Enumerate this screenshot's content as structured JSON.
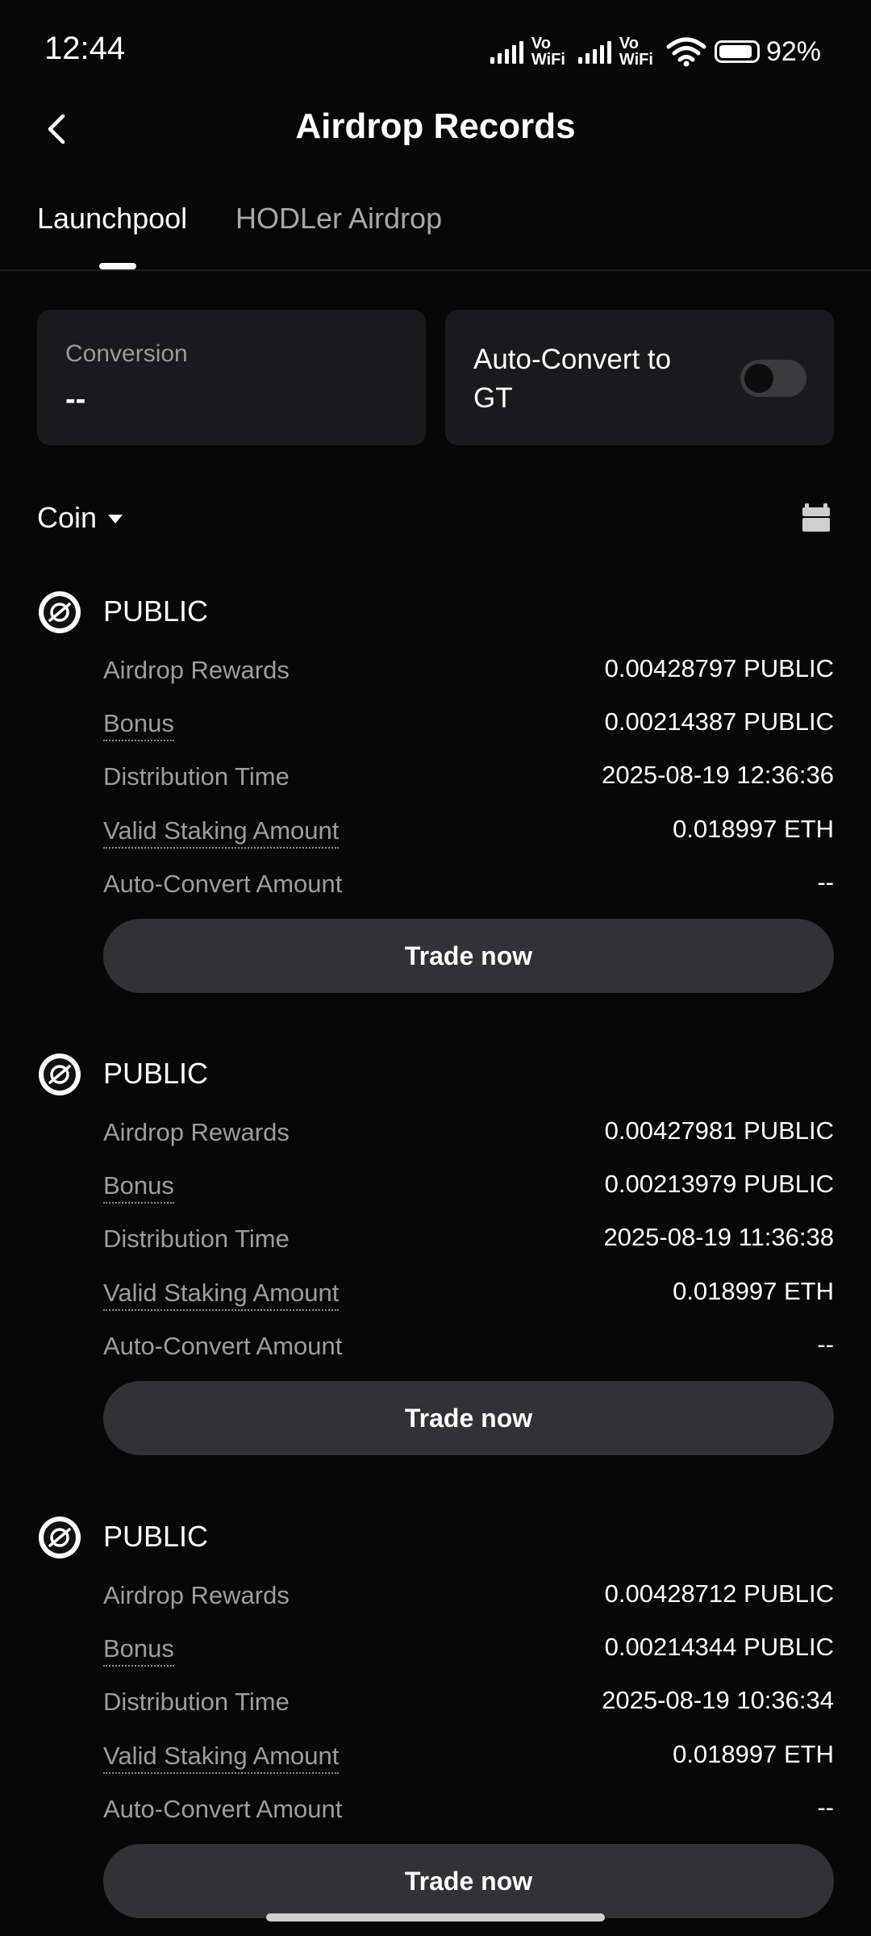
{
  "status_bar": {
    "time": "12:44",
    "vowifi_1": "Vo\nWiFi",
    "vowifi_2": "Vo\nWiFi",
    "battery": "92%"
  },
  "header": {
    "title": "Airdrop Records",
    "back_icon": "chevron-left-icon"
  },
  "tabs": [
    {
      "label": "Launchpool",
      "active": true
    },
    {
      "label": "HODLer Airdrop",
      "active": false
    }
  ],
  "summary": {
    "conversion_label": "Conversion",
    "conversion_value": "--",
    "auto_convert_label": "Auto-Convert to GT",
    "auto_convert_enabled": false
  },
  "filter": {
    "label": "Coin",
    "calendar_icon": "calendar-icon"
  },
  "records": [
    {
      "coin": "PUBLIC",
      "airdrop_rewards_label": "Airdrop Rewards",
      "airdrop_rewards": "0.00428797 PUBLIC",
      "bonus_label": "Bonus",
      "bonus": "0.00214387 PUBLIC",
      "distribution_time_label": "Distribution Time",
      "distribution_time": "2025-08-19 12:36:36",
      "valid_staking_label": "Valid Staking Amount",
      "valid_staking": "0.018997 ETH",
      "auto_convert_label": "Auto-Convert Amount",
      "auto_convert": "--",
      "button": "Trade now"
    },
    {
      "coin": "PUBLIC",
      "airdrop_rewards_label": "Airdrop Rewards",
      "airdrop_rewards": "0.00427981 PUBLIC",
      "bonus_label": "Bonus",
      "bonus": "0.00213979 PUBLIC",
      "distribution_time_label": "Distribution Time",
      "distribution_time": "2025-08-19 11:36:38",
      "valid_staking_label": "Valid Staking Amount",
      "valid_staking": "0.018997 ETH",
      "auto_convert_label": "Auto-Convert Amount",
      "auto_convert": "--",
      "button": "Trade now"
    },
    {
      "coin": "PUBLIC",
      "airdrop_rewards_label": "Airdrop Rewards",
      "airdrop_rewards": "0.00428712 PUBLIC",
      "bonus_label": "Bonus",
      "bonus": "0.00214344 PUBLIC",
      "distribution_time_label": "Distribution Time",
      "distribution_time": "2025-08-19 10:36:34",
      "valid_staking_label": "Valid Staking Amount",
      "valid_staking": "0.018997 ETH",
      "auto_convert_label": "Auto-Convert Amount",
      "auto_convert": "--",
      "button": "Trade now"
    }
  ]
}
